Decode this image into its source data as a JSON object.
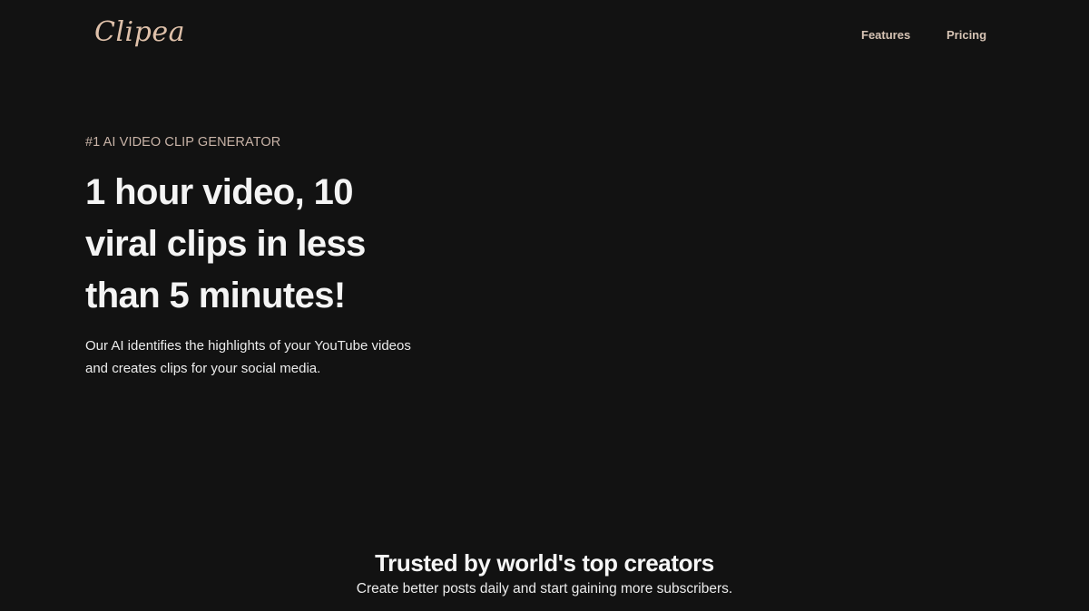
{
  "header": {
    "logo": "Clipea",
    "nav": {
      "features": "Features",
      "pricing": "Pricing"
    }
  },
  "hero": {
    "eyebrow": "#1 AI VIDEO CLIP GENERATOR",
    "headline": "1 hour video, 10 viral clips in less than 5 minutes!",
    "subtext": "Our AI identifies the highlights of your YouTube videos and creates clips for your social media."
  },
  "trusted": {
    "title": "Trusted by world's top creators",
    "subtitle": "Create better posts daily and start gaining more subscribers."
  },
  "colors": {
    "background": "#121212",
    "brand": "#dfc1aa",
    "nav_text": "#d6c3b4",
    "eyebrow_text": "#c8b3a7",
    "heading_text": "#f4f4f4"
  }
}
